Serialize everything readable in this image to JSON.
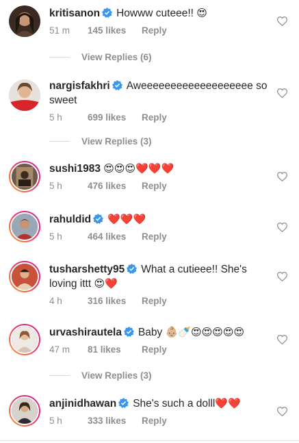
{
  "comments": [
    {
      "user": "kritisanon",
      "text": "Howww cuteee!!",
      "emoji": "😍",
      "time": "51 m",
      "likes": "145 likes",
      "reply": "Reply"
    },
    {
      "user": "nargisfakhri",
      "text": "Aweeeeeeeeeeeeeeeeeee so sweet",
      "emoji": "",
      "time": "5 h",
      "likes": "699 likes",
      "reply": "Reply"
    },
    {
      "user": "sushi1983",
      "text": "",
      "emoji": "😍😍😍❤️❤️❤️",
      "time": "5 h",
      "likes": "476 likes",
      "reply": "Reply"
    },
    {
      "user": "rahuldid",
      "text": "",
      "emoji": "❤️❤️❤️",
      "time": "5 h",
      "likes": "464 likes",
      "reply": "Reply"
    },
    {
      "user": "tusharshetty95",
      "text": "What a cutieee!! She's loving ittt",
      "emoji": "😍❤️",
      "time": "4 h",
      "likes": "316 likes",
      "reply": "Reply"
    },
    {
      "user": "urvashirautela",
      "text": "Baby",
      "emoji": "👶🏼🍼😍😍😍😍😍",
      "time": "47 m",
      "likes": "81 likes",
      "reply": "Reply"
    },
    {
      "user": "anjinidhawan",
      "text": "She's such a dolll",
      "emoji": "❤️❤️",
      "time": "5 h",
      "likes": "333 likes",
      "reply": "Reply"
    }
  ],
  "view_replies": [
    {
      "label": "View Replies (6)"
    },
    {
      "label": "View Replies (3)"
    },
    {
      "label": "View Replies (3)"
    }
  ],
  "icons": {
    "verified": "verified-badge-icon",
    "like": "heart-outline-icon"
  },
  "colors": {
    "verified": "#3897f0",
    "muted": "#8e8e8e",
    "text": "#262626"
  }
}
